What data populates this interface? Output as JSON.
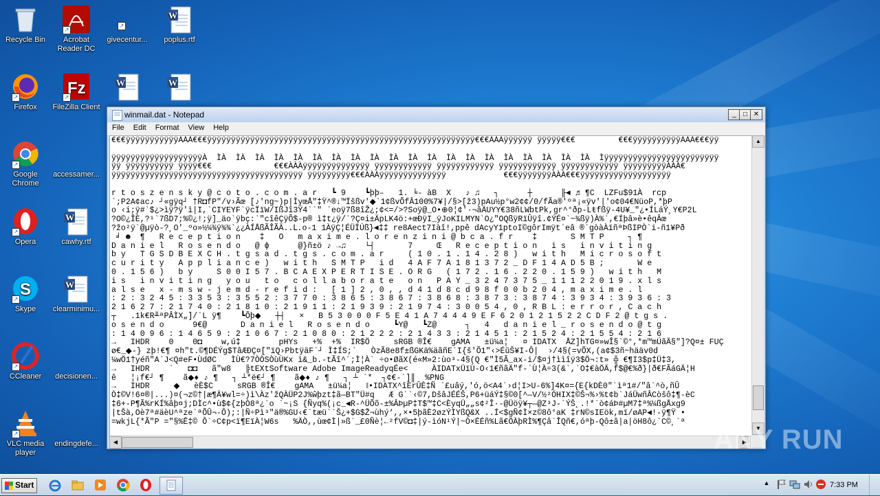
{
  "desktop": {
    "icons": [
      {
        "label": "Recycle Bin",
        "icon": "recycle-bin-icon"
      },
      {
        "label": "Acrobat Reader DC",
        "icon": "acrobat-icon"
      },
      {
        "label": "givecentur...",
        "icon": "blank-file-icon"
      },
      {
        "label": "poplus.rtf",
        "icon": "word-doc-icon"
      },
      {
        "label": "Firefox",
        "icon": "firefox-icon"
      },
      {
        "label": "FileZilla Client",
        "icon": "filezilla-icon"
      },
      {
        "label": "",
        "icon": "word-doc-icon"
      },
      {
        "label": "",
        "icon": "word-doc-icon"
      },
      {
        "label": "Google Chrome",
        "icon": "chrome-icon"
      },
      {
        "label": "accessamer...",
        "icon": "blank-file-icon"
      },
      {
        "label": "Opera",
        "icon": "opera-icon"
      },
      {
        "label": "cawhy.rtf",
        "icon": "word-doc-icon"
      },
      {
        "label": "Skype",
        "icon": "skype-icon"
      },
      {
        "label": "clearminimu...",
        "icon": "word-doc-icon"
      },
      {
        "label": "CCleaner",
        "icon": "ccleaner-icon"
      },
      {
        "label": "decisionen...",
        "icon": "blank-file-icon"
      },
      {
        "label": "VLC media player",
        "icon": "vlc-icon"
      },
      {
        "label": "endingdefe...",
        "icon": "blank-file-icon"
      }
    ]
  },
  "notepad": {
    "title": "winmail.dat - Notepad",
    "menu": [
      "File",
      "Edit",
      "Format",
      "View",
      "Help"
    ],
    "lines": [
      "€€€ÿÿÿÿÿÿÿÿÿÿÿÀÀÀ€€€ÿÿÿÿÿÿÿÿÿÿÿÿÿÿÿÿÿÿÿÿÿÿÿÿÿÿÿÿÿÿÿÿÿÿÿÿÿÿÿÿÿÿÿÿÿÿÿÿÿÿÿÿÿÿÿÿ€€€ÀÀÀÿÿÿÿÿÿ ÿÿÿÿÿ€€€         €€€ÿÿÿÿÿÿÿÿÿÿÀÀÀ€€€ÿÿ",
      "",
      "ÿÿÿÿÿÿÿÿÿÿÿÿÿÿÿÿÿÿÿÀ  ÌÀ  ÌÀ  ÌÀ  ÌÀ  ÌÀ  ÌÀ  ÌÀ  ÌÀ  ÌÀ  ÌÀ  ÌÀ  ÌÀ  ÌÀ  ÌÀ  ÌÀ  ÌÀ  ÌÀ  ÌÀ  ÌÀ  ÌÀ  Ìÿÿÿÿÿÿÿÿÿÿÿÿÿÿÿÿÿÿÿÿÿÿÿÿ",
      "ÿÿ ÿÿÿÿÿÿÿÿÿÿ ÿÿÿÿ€€€             €€€ÀÀÀÿÿÿÿÿÿÿÿÿÿÿÿÿÿ ÿÿÿÿÿÿÿÿÿÿÿÿ ÿÿÿÿÿÿÿÿÿÿÿÿ ÿÿÿÿÿÿÿÿÿÿÿÿ ÿÿÿÿÿÿÿÿÿÿÿÿ ÿÿÿÿÿÿÿÿÿÀÀÀ€",
      "ÿÿÿÿÿÿÿÿÿÿÿÿÿÿÿÿÿÿÿÿÿÿÿÿÿÿÿÿÿÿÿÿÿÿÿÿÿÿÿÿ ÿÿÿÿÿÿÿÿÿ€€€ÀÀÀÿÿÿÿÿÿÿÿÿÿÿÿÿÿ            €€€ÿÿÿÿÿÿÿÀÀÀ€€€ÿÿÿÿÿÿÿÿÿÿÿÿÿÿÿÿÿÿÿ",
      "",
      "r t o s z e n s k y @ c o t o . c o m . a r   ┗ 9    ┗þþ–   1. ╘- àB  X   ♪ ♫   ┐      ┼      ╟◄ ♬ ¶C  LZFu$91À  rcp",
      "`;P2A¢ac♪ ┘«gÿq┘ †R◘fP\"/v›Ãœ [♪'ng~)p|ÌyœÅ\"‡Ÿ^®↓™Ïšßv'◆`1¢ßvÕfÂ100%7¥|/§>[ž3)pAu½p°w2¢¢/0/fÃa®'ºª¡«ÿv'|'o¢04€NüoP,*þP",
      "o ‹i;ÿ#`$¿>ìÿ?ÿ'ì|I,`CIYEYF`ÿcÏïW/IßJî3Ý4``\" `eoÿ7ß8îŽ¿;¢<=/>?Soÿ@_O•⊕0¦¢'·¬âÄUYY€38ñLWbtPk,gr^°ðp-Lŧfßÿ-4U¥_\"¿•ÍLáÝ¸Y€P2L",
      "?O©¿ÎÈ,?¹`7ßD7;%©¿!;ÿ]_äo`ÿbç:`\"cîêÇÿÕ$-p® ì‡t¿ÿ/`?Ç¤i±ÄpLK4ö:+œÐÿI_ÿJoKILMYN`O¿\"OQßÿRïÛÿî.¢ÝÉ¤`~¾ßÿ)À%`,€Íþâ»è•êqÂœ",
      "?žo²ÿ`@µÿò-?¸O'_ºo»½¼¾ÿ¾¾`¿¿ÀÍÅßÃÎÃÄ..Լ.o-1 1ÀÿÇ¦ÉÜÏÚß}◄‡‡ re8Aect7Iàî!,ppê dAcyY1ptoI©gôrImÿt`eâ ®`gòàÀïñªÞßIPÒ`i-ñ1¥Pð",
      " ╛ ☻  ¶   R e c e p t i o n    ‡   O   m a x i m e . l o r e n z i n i @ b c a . f r    ‡       S M T P     ┐ ¶",
      "D a n i e l   R o s e n d o   @ ɸ      @}ñ±ö ♪ →♫    └┤       7     Œ   R e c e p t i o n   i s   i n v i t i n g",
      "b y   T G S D B E X C H . t g s a d . t g s . c o m . a r     ( 1 0 . 1 . 1 4 . 2 8 )   w i t h   M i c r o s o f t",
      "c u r i t y   A p p l i a n c e )   w i t h   S M T P   i d   4 A F 7 A 1 8 1 3 7 2 _ D F 1 4 A D 5 B ;       W e",
      "0 . 1 5 6 )   b y     S 0 0 I 5 7 . B C A E X P E R T I S E . O R G   ( 1 7 2 . 1 6 . 2 2 0 . 1 5 9 )   w i t h   M",
      "i s   i n v i t i n g   y o u   t o   c o l l a b o r a t e   o n   P A Y _ 3 2 4 7 3 7 5 _ 1 1 1 2 2 0 1 9 . x l s",
      "a l s e   x - m s w - j e m d - r e f i d :   [ 1 ] 2 , 0 , , d 4 1 d 8 c d 9 8 f 0 0 b 2 0 4 , m a x i m e . l",
      ": 2 : 3 2 4 5 : 3 3 5 3 : 3 5 5 2 : 3 7 7 0 : 3 8 6 5 : 3 8 6 7 : 3 8 6 8 : 3 8 7 3 : 3 8 7 4 : 3 9 3 4 : 3 9 3 6 : 3",
      "2 1 6 2 7 : 2 1 7 4 0 : 2 1 8 1 0 : 2 1 9 1 1 : 2 1 9 3 9 : 2 1 9 7 4 : 3 0 0 5 4 , 0 , R B L : e r r o r , C a c h",
      "┬   .1k€R╨ªPÂÌX„]/`L ÿ¶    ┗Õþ◆   ┼┤   ×   B 5 3 0 0 0 F 5 E 4 1 A 7 4 4 4 9 E F 6 2 0 1 2 1 5 2 2 C D F 2 @ t g s .",
      "o s e n d o      9€@       D a n i e l   R o s e n d o     ┗Y@   ┗Z@      ┐   4   d a n i e l _ r o s e n d o @ t g",
      ": 1 4 0 9 6 : 1 4 6 5 9 : 2 1 0 6 7 : 2 1 0 8 0 : 2 1 2 2 2 : 2 1 4 3 3 : 2 1 4 5 1 : 2 1 5 2 4 : 2 1 5 5 4 : 2 1 6",
      "→   IHDR    0    0◘    w,ú‡        pHYs   +%  +%  IR$Ö     sRGB ®Î€    gAMA   ±ü¼a¦   ¤ IDATX  ÅZ]hTG¤»wÎ§`©°,*m™mÚãÄ§\"]?Q¤± FUÇ",
      "ø€_◆-} zþ!€¶ ¤h\"t.©¶DÉÝg$TâÆÐÇ¤[\"ïQ›PbtÿäF`┘ Ì‡ÍS;`   ÒzÃ8e8f±ßGKä%äãñE`I{š'Õ1\"‹>ÉŭŠ¥I-Ô|  ›/4§(=vÕX,(a¢$3ñ~hääv0d",
      "¼wÖ1†yéñ\"A`J<Q#eF•ÙdØC   ÌÙ€?7ÒÒSÒùÙKx ì&_b.-tÃî^´;Ì¦À` ÷o•ØãX(é«M»2:ùo³-4§(Q €\"Ì5Ã_ax-i/$¤j†ììîÿ3$Ö¬:t» ╬ €¶I3$p‡Ü‡3,",
      "→   IHDR    `   ◘◘   ã\"w8   ╠tEXtSoftware Adobe ImageReadyqÉe<     ÀIDATxÜïÙ-O‹1€ñãÄ\"f-`Ù¦À÷3(&`,`O‡€àÖÄ,f$@€%ð}|ð€FÃáGÄ¦H",
      "ê   ¦¡f€┘ ¶    ã◆♦ ♪ ¶   ┐ ┴*ë€┘ ¶    ã◆♦ ♪ ¶   ┐ ┴ `*  ┐¢€-`]║  %PNG",
      "→   IHDR     ◆   èÈ$C     sRGB ®Î€    gAMA   ±ü¼a¦   ‖•IDATX^îÈrÛÈ‡Ñ `£uâý,'ó,ö<A4`›d¦I>U-6%]4K¤={E{kDÈ0\"`ìª1#/\"â`^ò,ñÛ",
      "Ò‡©V!6¤®|...)¤(¬z©†|æ¶Ä¥wl=÷)ì\\Àz'žQÀÜP2J%ŵþzt‡ã—BT\"Ü#q   Æ G``‹©7,DšâJÉÉŠ,P6+üáÝ‡§©0[^—V/½²ÓHIX‡©Š¬%›%t¢b`JáÜwñÂCòšô‡¶-èC",
      "‡6+-P¶Ã%rKÍ%âþ¤j;DÌc^•ù$¢{zþÒ8ª¿`o `~¡S {Ñyq%(¡c_◄R-^ÜÕõ-±%ÂÞµP‡T$™‡C<ÈyqÜ„„s¢²Î·-@Üöÿ¥┬—@Z³J-`ÝŠ¸.!*`ò¢áÞ#µM7‡ª%¼ßgÅxg9",
      "|tŠà,Oè7ª#äèU^ªze`ªÕÛ¬-Ô);:|Ñ÷Pì³\"ä®%GU‹€`tæü``Š¿+$G$Ž¬ùhý‘,,×•5þãÈ2øzÝÌYßQ&X ..Í<$gÑ¢Ì×z©8ô°aK ‡rN©sIEök,mï/øAP◄!-ÿ¶Ÿ •",
      "=wkjL{*Ã\"P =\"§%Ê‡© Ô`÷C¢p<ï¶EïÀ¦W6s   %ÄÒ,,ùœ¢Ì|»ß`_£0Ñè¦←²fV©◘‡|ý-ìóN¹Ý|~Ò×ÉÉñ%Lã€ÖÀþRÌ%¶Çâ`ÎQñ€,óªþ-Qô±â|a|öH8ô¿`C©¸`ª"
    ]
  },
  "taskbar": {
    "start_label": "Start",
    "clock": "7:33 PM",
    "pinned": [
      "ie-icon",
      "explorer-icon",
      "media-player-icon",
      "chrome-icon",
      "opera-icon",
      "notepad-icon"
    ]
  },
  "watermark": "ANY RUN",
  "colors": {
    "desktop_blue": "#1f7fd3",
    "titlebar": "#c9dcf2",
    "taskbar": "#d3dfed"
  }
}
